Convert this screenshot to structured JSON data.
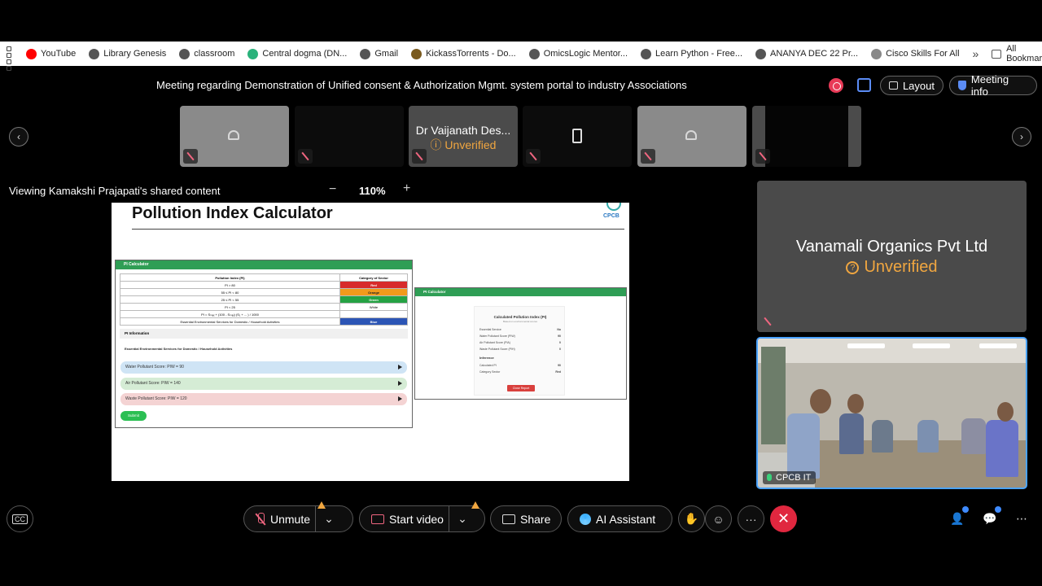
{
  "bookmarks": {
    "items": [
      {
        "label": "YouTube",
        "color": "#ff0000"
      },
      {
        "label": "Library Genesis",
        "color": "#555555"
      },
      {
        "label": "classroom",
        "color": "#555555"
      },
      {
        "label": "Central dogma (DN...",
        "color": "#2ab27b"
      },
      {
        "label": "Gmail",
        "color": "#555555"
      },
      {
        "label": "KickassTorrents - Do...",
        "color": "#7a5a1e"
      },
      {
        "label": "OmicsLogic Mentor...",
        "color": "#555555"
      },
      {
        "label": "Learn Python - Free...",
        "color": "#555555"
      },
      {
        "label": "ANANYA DEC 22 Pr...",
        "color": "#555555"
      },
      {
        "label": "Cisco Skills For All",
        "color": "#888888"
      }
    ],
    "more": "»",
    "all_bookmarks": "All Bookmarks"
  },
  "meeting": {
    "title": "Meeting regarding Demonstration of Unified consent & Authorization Mgmt. system portal to industry Associations",
    "layout_label": "Layout",
    "info_label": "Meeting info"
  },
  "filmstrip": {
    "prev": "‹",
    "next": "›",
    "featured_name": "Dr Vaijanath Des...",
    "featured_status": "Unverified"
  },
  "share": {
    "viewing_text": "Viewing Kamakshi Prajapati's shared content",
    "zoom_minus": "−",
    "zoom": "110%",
    "zoom_plus": "+"
  },
  "slide": {
    "title": "Pollution Index Calculator",
    "logo_text": "CPCB",
    "pi_panel_title": "PI Calculator",
    "table_headers": [
      "Pollution Index (PI)",
      "Category of Sector"
    ],
    "table_rows": [
      {
        "range": "PI > 80",
        "category": "Red",
        "cls": "c-red"
      },
      {
        "range": "55 ≤ PI < 80",
        "category": "Orange",
        "cls": "c-orange"
      },
      {
        "range": "25 ≤ PI < 55",
        "category": "Green",
        "cls": "c-green"
      },
      {
        "range": "PI < 25",
        "category": "White",
        "cls": ""
      },
      {
        "range": "PI = Sₘₐₓ + (100 - Sₘₐₓ) (S₁ + ... ) / 1000",
        "category": "",
        "cls": ""
      },
      {
        "range": "Essential Environmental Services for Domestic / Household Activities",
        "category": "Blue",
        "cls": "c-blue"
      }
    ],
    "pi_info": "PI Information",
    "essential": "Essential Environmental Services for Domestic / Household Activities",
    "water_score": "Water Pollutant Score: PIW = 90",
    "air_score": "Air Pollutant Score: PIW = 140",
    "waste_score": "Waste Pollutant Score: PIW = 120",
    "submit": "Submit",
    "calc_panel_title": "PI Calculator",
    "calc_title": "Calculated Pollution Index (PI)",
    "calc_sub": "Based on environmental scores",
    "calc_rows": [
      {
        "label": "Essential Service",
        "value": "No"
      },
      {
        "label": "Water Pollutant Score (PIW)",
        "value": "90"
      },
      {
        "label": "Air Pollutant Score (PIA)",
        "value": "0"
      },
      {
        "label": "Waste Pollutant Score (PIH)",
        "value": "0"
      }
    ],
    "inference": "Inference",
    "calc_rows2": [
      {
        "label": "Calculated PI",
        "value": "90"
      },
      {
        "label": "Category Sector",
        "value": "Red"
      }
    ],
    "close_btn": "Close Report"
  },
  "participant": {
    "name": "Vanamali Organics Pvt Ltd",
    "status": "Unverified"
  },
  "video": {
    "label": "CPCB IT"
  },
  "controls": {
    "cc": "CC",
    "unmute": "Unmute",
    "start_video": "Start video",
    "share": "Share",
    "ai_assistant": "AI Assistant",
    "more": "···",
    "end": "✕",
    "chevron": "⌄",
    "accent_red": "#e0273f"
  }
}
